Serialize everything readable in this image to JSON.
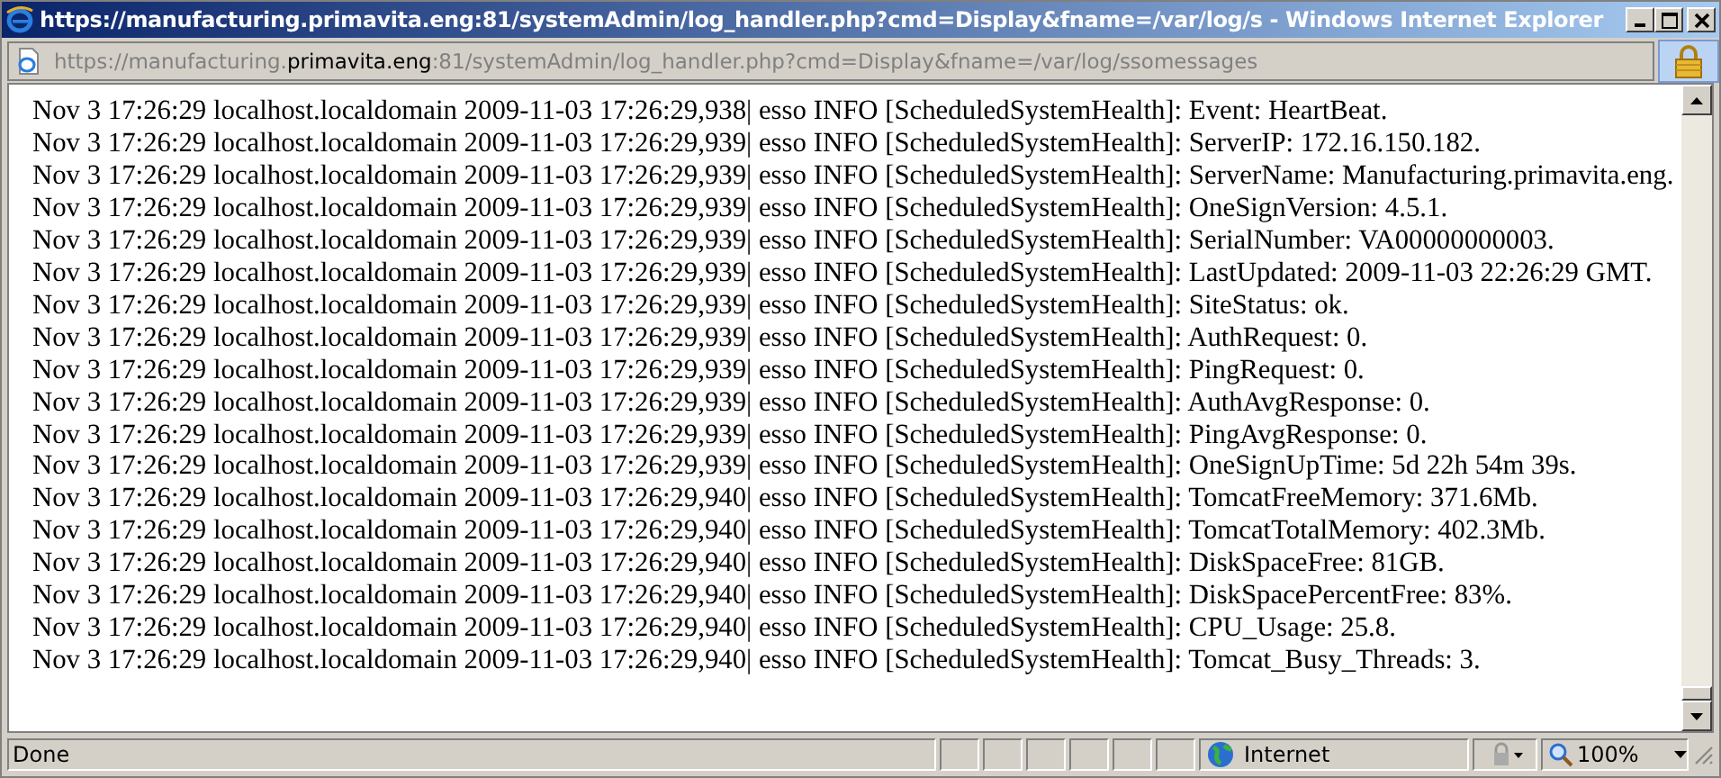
{
  "window": {
    "title": "https://manufacturing.primavita.eng:81/systemAdmin/log_handler.php?cmd=Display&fname=/var/log/s - Windows Internet Explorer"
  },
  "address": [
    {
      "text": "https://",
      "emphasized": false
    },
    {
      "text": "manufacturing.",
      "emphasized": false
    },
    {
      "text": "primavita.eng",
      "emphasized": true
    },
    {
      "text": ":81/systemAdmin/log_handler.php?cmd=Display&fname=/var/log/ssomessages",
      "emphasized": false
    }
  ],
  "log_lines": [
    "Nov 3 17:26:29 localhost.localdomain 2009-11-03 17:26:29,938| esso INFO [ScheduledSystemHealth]: Event: HeartBeat.",
    "Nov 3 17:26:29 localhost.localdomain 2009-11-03 17:26:29,939| esso INFO [ScheduledSystemHealth]: ServerIP: 172.16.150.182.",
    "Nov 3 17:26:29 localhost.localdomain 2009-11-03 17:26:29,939| esso INFO [ScheduledSystemHealth]: ServerName: Manufacturing.primavita.eng.",
    "Nov 3 17:26:29 localhost.localdomain 2009-11-03 17:26:29,939| esso INFO [ScheduledSystemHealth]: OneSignVersion: 4.5.1.",
    "Nov 3 17:26:29 localhost.localdomain 2009-11-03 17:26:29,939| esso INFO [ScheduledSystemHealth]: SerialNumber: VA00000000003.",
    "Nov 3 17:26:29 localhost.localdomain 2009-11-03 17:26:29,939| esso INFO [ScheduledSystemHealth]: LastUpdated: 2009-11-03 22:26:29 GMT.",
    "Nov 3 17:26:29 localhost.localdomain 2009-11-03 17:26:29,939| esso INFO [ScheduledSystemHealth]: SiteStatus: ok.",
    "Nov 3 17:26:29 localhost.localdomain 2009-11-03 17:26:29,939| esso INFO [ScheduledSystemHealth]: AuthRequest: 0.",
    "Nov 3 17:26:29 localhost.localdomain 2009-11-03 17:26:29,939| esso INFO [ScheduledSystemHealth]: PingRequest: 0.",
    "Nov 3 17:26:29 localhost.localdomain 2009-11-03 17:26:29,939| esso INFO [ScheduledSystemHealth]: AuthAvgResponse: 0.",
    "Nov 3 17:26:29 localhost.localdomain 2009-11-03 17:26:29,939| esso INFO [ScheduledSystemHealth]: PingAvgResponse: 0.",
    "Nov 3 17:26:29 localhost.localdomain 2009-11-03 17:26:29,939| esso INFO [ScheduledSystemHealth]: OneSignUpTime: 5d 22h 54m 39s.",
    "Nov 3 17:26:29 localhost.localdomain 2009-11-03 17:26:29,940| esso INFO [ScheduledSystemHealth]: TomcatFreeMemory: 371.6Mb.",
    "Nov 3 17:26:29 localhost.localdomain 2009-11-03 17:26:29,940| esso INFO [ScheduledSystemHealth]: TomcatTotalMemory: 402.3Mb.",
    "Nov 3 17:26:29 localhost.localdomain 2009-11-03 17:26:29,940| esso INFO [ScheduledSystemHealth]: DiskSpaceFree: 81GB.",
    "Nov 3 17:26:29 localhost.localdomain 2009-11-03 17:26:29,940| esso INFO [ScheduledSystemHealth]: DiskSpacePercentFree: 83%.",
    "Nov 3 17:26:29 localhost.localdomain 2009-11-03 17:26:29,940| esso INFO [ScheduledSystemHealth]: CPU_Usage: 25.8.",
    "Nov 3 17:26:29 localhost.localdomain 2009-11-03 17:26:29,940| esso INFO [ScheduledSystemHealth]: Tomcat_Busy_Threads: 3."
  ],
  "status_bar": {
    "status": "Done",
    "zone": "Internet",
    "zoom": "100%"
  }
}
